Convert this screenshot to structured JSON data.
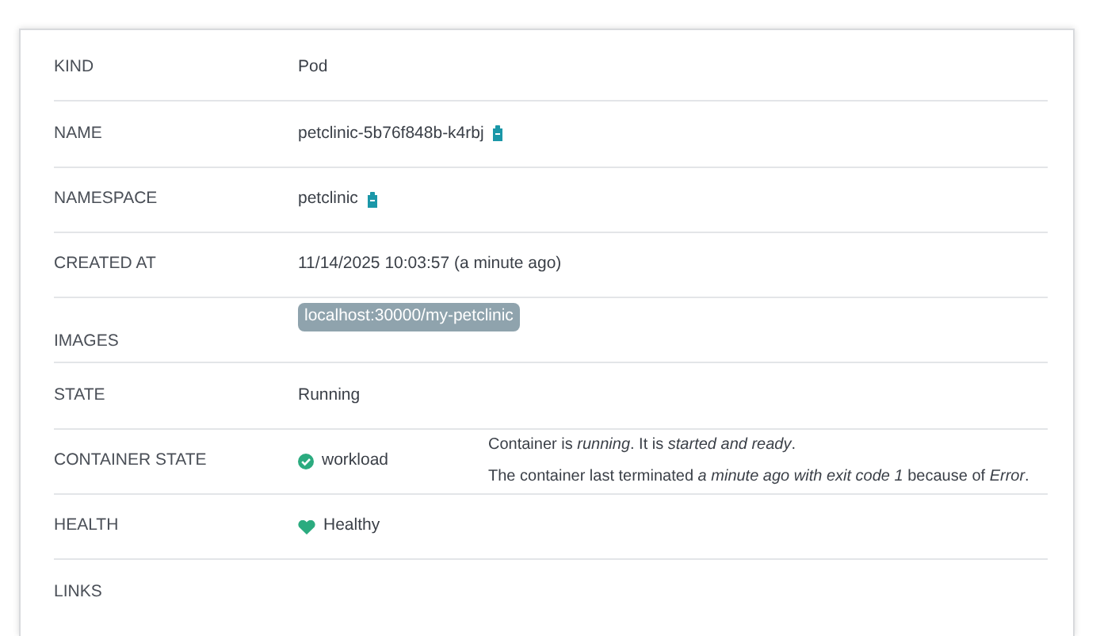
{
  "rows": [
    {
      "label": "KIND",
      "kind": "text",
      "value": "Pod"
    },
    {
      "label": "NAME",
      "kind": "copy",
      "value": "petclinic-5b76f848b-k4rbj"
    },
    {
      "label": "NAMESPACE",
      "kind": "copy",
      "value": "petclinic"
    },
    {
      "label": "CREATED AT",
      "kind": "text",
      "value": "11/14/2025 10:03:57  (a minute ago)"
    },
    {
      "label": "IMAGES",
      "kind": "chips",
      "chips": [
        "localhost:30000/my-petclinic"
      ]
    },
    {
      "label": "STATE",
      "kind": "text",
      "value": "Running"
    },
    {
      "label": "CONTAINER STATE",
      "kind": "container",
      "value": "workload",
      "messages": [
        "Container is *running*. It is *started and ready*.",
        "The container last terminated *a minute ago with exit code 1* because of *Error*."
      ]
    },
    {
      "label": "HEALTH",
      "kind": "health",
      "value": "Healthy"
    },
    {
      "label": "LINKS",
      "kind": "empty"
    }
  ]
}
